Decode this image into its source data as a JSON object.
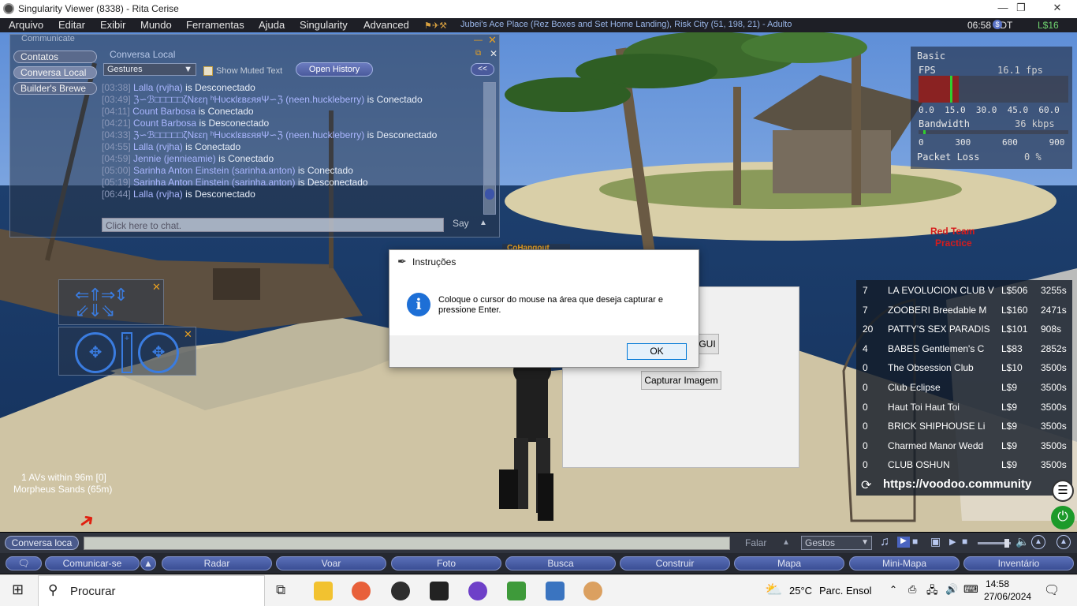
{
  "window": {
    "title": "Singularity Viewer (8338) - Rita Cerise",
    "minimize": "—",
    "restore": "❐",
    "close": "✕"
  },
  "menu": {
    "items": [
      "Arquivo",
      "Editar",
      "Exibir",
      "Mundo",
      "Ferramentas",
      "Ajuda",
      "Singularity",
      "Advanced"
    ],
    "location": "Jubei's Ace Place (Rez Boxes and Set Home Landing), Risk City (51, 198, 21) - Adulto",
    "clock": "06:58 PDT",
    "balance": "L$16"
  },
  "communicate": {
    "title": "Communicate",
    "tabs": [
      "Contatos",
      "Conversa Local",
      "Builder's Brewe"
    ],
    "panel_title": "Conversa Local",
    "gestures": "Gestures",
    "show_muted": "Show Muted Text",
    "open_history": "Open History",
    "collapse": "<<",
    "lines": [
      {
        "time": "[03:38]",
        "name": "Lalla (rvjha)",
        "status": "is Desconectado"
      },
      {
        "time": "[03:49]",
        "name": "ℨ∽ℬ□□□□□ζNεεη ʰHυcκlεвεяяΨ∽ℨ (neen.huckleberry)",
        "status": "is Conectado"
      },
      {
        "time": "[04:11]",
        "name": "Count Barbosa",
        "status": "is Conectado"
      },
      {
        "time": "[04:21]",
        "name": "Count Barbosa",
        "status": "is Desconectado"
      },
      {
        "time": "[04:33]",
        "name": "ℨ∽ℬ□□□□□ζNεεη ʰHυcκlεвεяяΨ∽ℨ (neen.huckleberry)",
        "status": "is Desconectado"
      },
      {
        "time": "[04:55]",
        "name": "Lalla (rvjha)",
        "status": "is Conectado"
      },
      {
        "time": "[04:59]",
        "name": "Jennie (jennieamie)",
        "status": "is Conectado"
      },
      {
        "time": "[05:00]",
        "name": "Sarinha Anton Einstein (sarinha.anton)",
        "status": "is Conectado"
      },
      {
        "time": "[05:19]",
        "name": "Sarinha Anton Einstein (sarinha.anton)",
        "status": "is Desconectado"
      },
      {
        "time": "[06:44]",
        "name": "Lalla (rvjha)",
        "status": "is Desconectado"
      }
    ],
    "input_placeholder": "Click here to chat.",
    "say": "Say"
  },
  "hangout_label": "CoHangout",
  "dialog": {
    "title": "Instruções",
    "message_line1": "Coloque o cursor do mouse na área que deseja capturar e",
    "message_line2": "pressione Enter.",
    "ok": "OK"
  },
  "capture_window": {
    "gui_button": "GUI",
    "capture_button": "Capturar Imagem"
  },
  "stats": {
    "section": "Basic",
    "fps_label": "FPS",
    "fps_value": "16.1 fps",
    "fps_ticks": "0.0  15.0  30.0  45.0  60.0",
    "bw_label": "Bandwidth",
    "bw_value": "36 kbps",
    "bw_ticks": "0      300      600      900",
    "pl_label": "Packet Loss",
    "pl_value": "0 %",
    "fps_fraction": 0.27
  },
  "scene_labels": {
    "red_team": "Red Team",
    "practice": "Practice"
  },
  "avs": {
    "line1": "1 AVs within 96m [0]",
    "line2": "Morpheus Sands (65m)"
  },
  "radar": {
    "rows": [
      {
        "count": "7",
        "name": "LA EVOLUCION CLUB V",
        "price": "L$506",
        "time": "3255s"
      },
      {
        "count": "7",
        "name": "ZOOBERI Breedable M",
        "price": "L$160",
        "time": "2471s"
      },
      {
        "count": "20",
        "name": "PATTY'S SEX PARADIS",
        "price": "L$101",
        "time": "908s"
      },
      {
        "count": "4",
        "name": "BABES Gentlemen's C",
        "price": "L$83",
        "time": "2852s"
      },
      {
        "count": "0",
        "name": "The Obsession Club",
        "price": "L$10",
        "time": "3500s"
      },
      {
        "count": "0",
        "name": "Club Eclipse",
        "price": "L$9",
        "time": "3500s"
      },
      {
        "count": "0",
        "name": "Haut Toi Haut Toi",
        "price": "L$9",
        "time": "3500s"
      },
      {
        "count": "0",
        "name": "BRICK SHIPHOUSE  Li",
        "price": "L$9",
        "time": "3500s"
      },
      {
        "count": "0",
        "name": "Charmed Manor  Wedd",
        "price": "L$9",
        "time": "3500s"
      },
      {
        "count": "0",
        "name": "CLUB OSHUN",
        "price": "L$9",
        "time": "3500s"
      }
    ],
    "url": "https://voodoo.community"
  },
  "chatbar": {
    "channel": "Conversa loca",
    "speak": "Falar",
    "gestures": "Gestos"
  },
  "bottom_buttons": {
    "communicate": "Comunicar-se",
    "items": [
      "Radar",
      "Voar",
      "Foto",
      "Busca",
      "Construir",
      "Mapa",
      "Mini-Mapa",
      "Inventário"
    ]
  },
  "taskbar": {
    "search": "Procurar",
    "weather_temp": "25°C",
    "weather_desc": "Parc. Ensol",
    "time": "14:58",
    "date": "27/06/2024"
  }
}
